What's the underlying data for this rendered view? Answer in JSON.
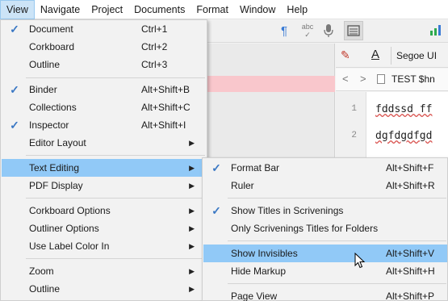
{
  "menubar": {
    "items": [
      "View",
      "Navigate",
      "Project",
      "Documents",
      "Format",
      "Window",
      "Help"
    ]
  },
  "toolbar": {
    "icons": [
      "paragraph-icon",
      "spellcheck-icon",
      "microphone-icon",
      "keyboard-icon",
      "stats-icon"
    ],
    "spell_label": "abc"
  },
  "format_bar": {
    "font_name": "Segoe UI"
  },
  "editor": {
    "doc_title": "TEST $hn",
    "lines": [
      {
        "num": "1",
        "text": "fddssd ff"
      },
      {
        "num": "2",
        "text": "dgfdgdfgd"
      }
    ]
  },
  "view_menu": {
    "items": [
      {
        "label": "Document",
        "shortcut": "Ctrl+1",
        "checked": true
      },
      {
        "label": "Corkboard",
        "shortcut": "Ctrl+2"
      },
      {
        "label": "Outline",
        "shortcut": "Ctrl+3"
      },
      {
        "label": "Binder",
        "shortcut": "Alt+Shift+B",
        "checked": true
      },
      {
        "label": "Collections",
        "shortcut": "Alt+Shift+C"
      },
      {
        "label": "Inspector",
        "shortcut": "Alt+Shift+I",
        "checked": true
      },
      {
        "label": "Editor Layout",
        "submenu": true
      },
      {
        "label": "Text Editing",
        "submenu": true,
        "highlighted": true
      },
      {
        "label": "PDF Display",
        "submenu": true
      },
      {
        "label": "Corkboard Options",
        "submenu": true
      },
      {
        "label": "Outliner Options",
        "submenu": true
      },
      {
        "label": "Use Label Color In",
        "submenu": true
      },
      {
        "label": "Zoom",
        "submenu": true
      },
      {
        "label": "Outline",
        "submenu": true
      }
    ]
  },
  "text_editing_menu": {
    "items": [
      {
        "label": "Format Bar",
        "shortcut": "Alt+Shift+F",
        "checked": true
      },
      {
        "label": "Ruler",
        "shortcut": "Alt+Shift+R"
      },
      {
        "label": "Show Titles in Scrivenings",
        "checked": true
      },
      {
        "label": "Only Scrivenings Titles for Folders"
      },
      {
        "label": "Show Invisibles",
        "shortcut": "Alt+Shift+V",
        "highlighted": true
      },
      {
        "label": "Hide Markup",
        "shortcut": "Alt+Shift+H"
      },
      {
        "label": "Page View",
        "shortcut": "Alt+Shift+P"
      }
    ]
  },
  "colors": {
    "highlight": "#91c9f7",
    "checkmark": "#3b78c4",
    "menu_bg": "#f2f2f2",
    "binder_pink": "#f9c7cc"
  }
}
